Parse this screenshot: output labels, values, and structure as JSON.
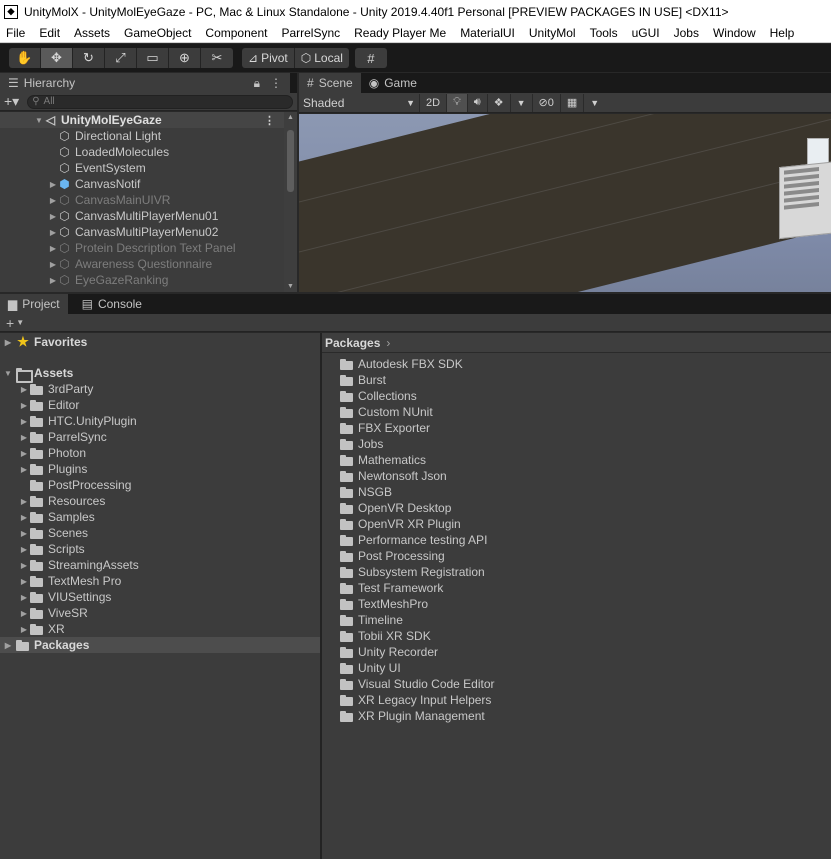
{
  "window": {
    "title": "UnityMolX - UnityMolEyeGaze - PC, Mac & Linux Standalone - Unity 2019.4.40f1 Personal [PREVIEW PACKAGES IN USE] <DX11>"
  },
  "menu": [
    "File",
    "Edit",
    "Assets",
    "GameObject",
    "Component",
    "ParrelSync",
    "Ready Player Me",
    "MaterialUI",
    "UnityMol",
    "Tools",
    "uGUI",
    "Jobs",
    "Window",
    "Help"
  ],
  "toolbar": {
    "pivot_label": "Pivot",
    "local_label": "Local"
  },
  "hierarchy": {
    "tab_label": "Hierarchy",
    "search_placeholder": "All",
    "scene_name": "UnityMolEyeGaze",
    "items": [
      {
        "label": "Directional Light",
        "arrow": "",
        "dim": false
      },
      {
        "label": "LoadedMolecules",
        "arrow": "",
        "dim": false
      },
      {
        "label": "EventSystem",
        "arrow": "",
        "dim": false
      },
      {
        "label": "CanvasNotif",
        "arrow": "▶",
        "dim": false,
        "blue": true
      },
      {
        "label": "CanvasMainUIVR",
        "arrow": "▶",
        "dim": true
      },
      {
        "label": "CanvasMultiPlayerMenu01",
        "arrow": "▶",
        "dim": false
      },
      {
        "label": "CanvasMultiPlayerMenu02",
        "arrow": "▶",
        "dim": false
      },
      {
        "label": "Protein Description Text Panel",
        "arrow": "▶",
        "dim": true
      },
      {
        "label": "Awareness Questionnaire",
        "arrow": "▶",
        "dim": true
      },
      {
        "label": "EyeGazeRanking",
        "arrow": "▶",
        "dim": true
      }
    ]
  },
  "scene_view": {
    "scene_tab": "Scene",
    "game_tab": "Game",
    "shading_mode": "Shaded",
    "mode_2d": "2D",
    "hidden_count": "0"
  },
  "project": {
    "project_tab": "Project",
    "console_tab": "Console",
    "favorites_label": "Favorites",
    "assets_label": "Assets",
    "packages_label": "Packages",
    "asset_folders": [
      {
        "label": "3rdParty",
        "arrow": true
      },
      {
        "label": "Editor",
        "arrow": true
      },
      {
        "label": "HTC.UnityPlugin",
        "arrow": true
      },
      {
        "label": "ParrelSync",
        "arrow": true
      },
      {
        "label": "Photon",
        "arrow": true
      },
      {
        "label": "Plugins",
        "arrow": true
      },
      {
        "label": "PostProcessing",
        "arrow": false
      },
      {
        "label": "Resources",
        "arrow": true
      },
      {
        "label": "Samples",
        "arrow": true
      },
      {
        "label": "Scenes",
        "arrow": true
      },
      {
        "label": "Scripts",
        "arrow": true
      },
      {
        "label": "StreamingAssets",
        "arrow": true
      },
      {
        "label": "TextMesh Pro",
        "arrow": true
      },
      {
        "label": "VIUSettings",
        "arrow": true
      },
      {
        "label": "ViveSR",
        "arrow": true
      },
      {
        "label": "XR",
        "arrow": true
      }
    ],
    "breadcrumb": "Packages",
    "packages": [
      "Autodesk FBX SDK",
      "Burst",
      "Collections",
      "Custom NUnit",
      "FBX Exporter",
      "Jobs",
      "Mathematics",
      "Newtonsoft Json",
      "NSGB",
      "OpenVR Desktop",
      "OpenVR XR Plugin",
      "Performance testing API",
      "Post Processing",
      "Subsystem Registration",
      "Test Framework",
      "TextMeshPro",
      "Timeline",
      "Tobii XR SDK",
      "Unity Recorder",
      "Unity UI",
      "Visual Studio Code Editor",
      "XR Legacy Input Helpers",
      "XR Plugin Management"
    ]
  },
  "colors": {
    "editor_bg": "#282828",
    "panel_bg": "#3c3c3c",
    "tab_bar_bg": "#191919",
    "prefab_blue": "#6ab5f0",
    "favorite_star": "#f0c419"
  }
}
